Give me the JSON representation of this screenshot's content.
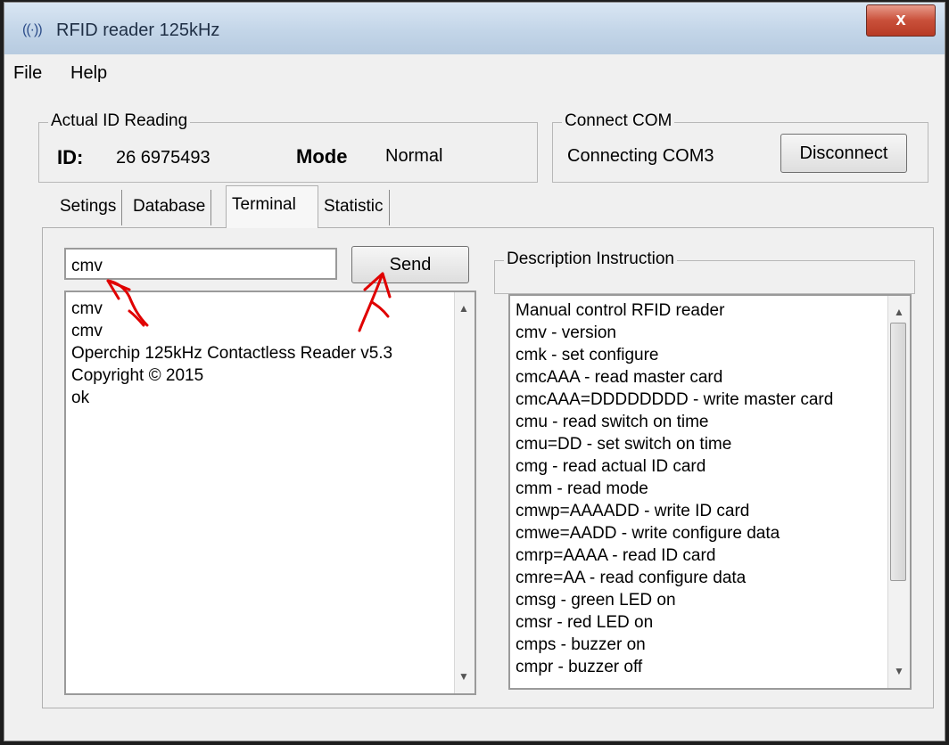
{
  "window": {
    "title": "RFID reader 125kHz",
    "app_icon": "((·))",
    "close_label": "x"
  },
  "menu": {
    "items": [
      "File",
      "Help"
    ]
  },
  "actual_id": {
    "legend": "Actual ID Reading",
    "id_label": "ID:",
    "id_value": "26 6975493",
    "mode_label": "Mode",
    "mode_value": "Normal"
  },
  "connect": {
    "legend": "Connect COM",
    "status": "Connecting COM3",
    "button": "Disconnect"
  },
  "tabs": [
    "Setings",
    "Database",
    "Terminal",
    "Statistic"
  ],
  "terminal": {
    "input_value": "cmv",
    "send_label": "Send",
    "output": [
      "cmv",
      "cmv",
      "Operchip 125kHz Contactless Reader v5.3",
      "Copyright © 2015",
      "ok"
    ]
  },
  "description": {
    "legend": "Description Instruction",
    "lines": [
      "Manual control RFID reader",
      "cmv - version",
      "cmk - set configure",
      "cmcAAA - read master card",
      "cmcAAA=DDDDDDDD - write master card",
      "cmu - read switch on time",
      "cmu=DD - set switch on time",
      "cmg - read actual ID card",
      "cmm - read mode",
      "cmwp=AAAADD - write ID card",
      "cmwe=AADD - write configure data",
      "cmrp=AAAA - read ID card",
      "cmre=AA - read configure data",
      "cmsg - green LED on",
      "cmsr - red LED on",
      "cmps - buzzer on",
      "cmpr - buzzer off"
    ]
  },
  "annotation_color": "#e00000"
}
